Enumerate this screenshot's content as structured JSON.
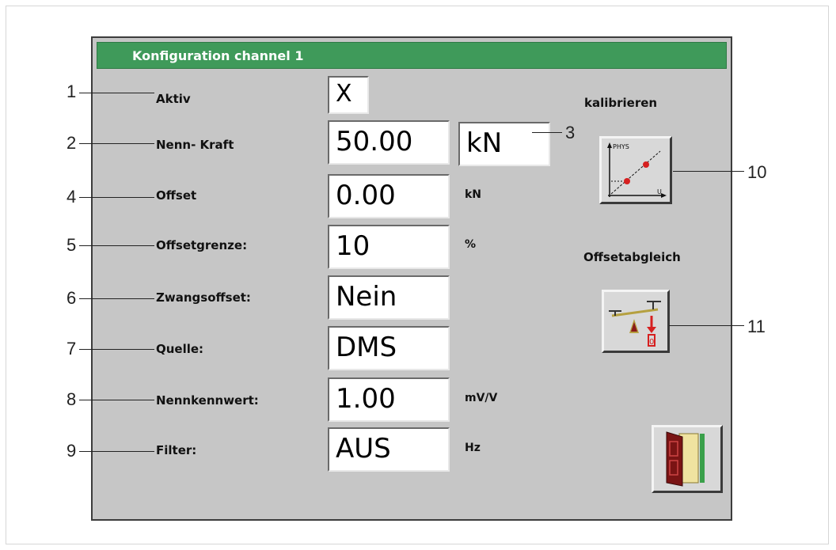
{
  "window": {
    "title": "Konfiguration channel 1"
  },
  "rows": [
    {
      "label": "Aktiv",
      "value": "X",
      "unit": ""
    },
    {
      "label": "Nenn- Kraft",
      "value": "50.00",
      "unit_box": "kN"
    },
    {
      "label": "Offset",
      "value": "0.00",
      "unit": "kN"
    },
    {
      "label": "Offsetgrenze:",
      "value": "10",
      "unit": "%"
    },
    {
      "label": "Zwangsoffset:",
      "value": "Nein",
      "unit": ""
    },
    {
      "label": "Quelle:",
      "value": "DMS",
      "unit": ""
    },
    {
      "label": "Nennkennwert:",
      "value": "1.00",
      "unit": "mV/V"
    },
    {
      "label": "Filter:",
      "value": "AUS",
      "unit": "Hz"
    }
  ],
  "side": {
    "calibrate_label": "kalibrieren",
    "offset_label": "Offsetabgleich",
    "chart_axis_y": "PHYS",
    "chart_axis_x": "U",
    "offset_icon_digit": "0"
  },
  "callouts": [
    "1",
    "2",
    "3",
    "4",
    "5",
    "6",
    "7",
    "8",
    "9",
    "10",
    "11"
  ],
  "colors": {
    "title_bar": "#3f9a5a",
    "window_bg": "#c6c6c6",
    "icon_red": "#d62020"
  },
  "icons": {
    "calibrate": "calibration-chart-icon",
    "offset": "balance-scale-icon",
    "exit": "exit-door-icon"
  }
}
